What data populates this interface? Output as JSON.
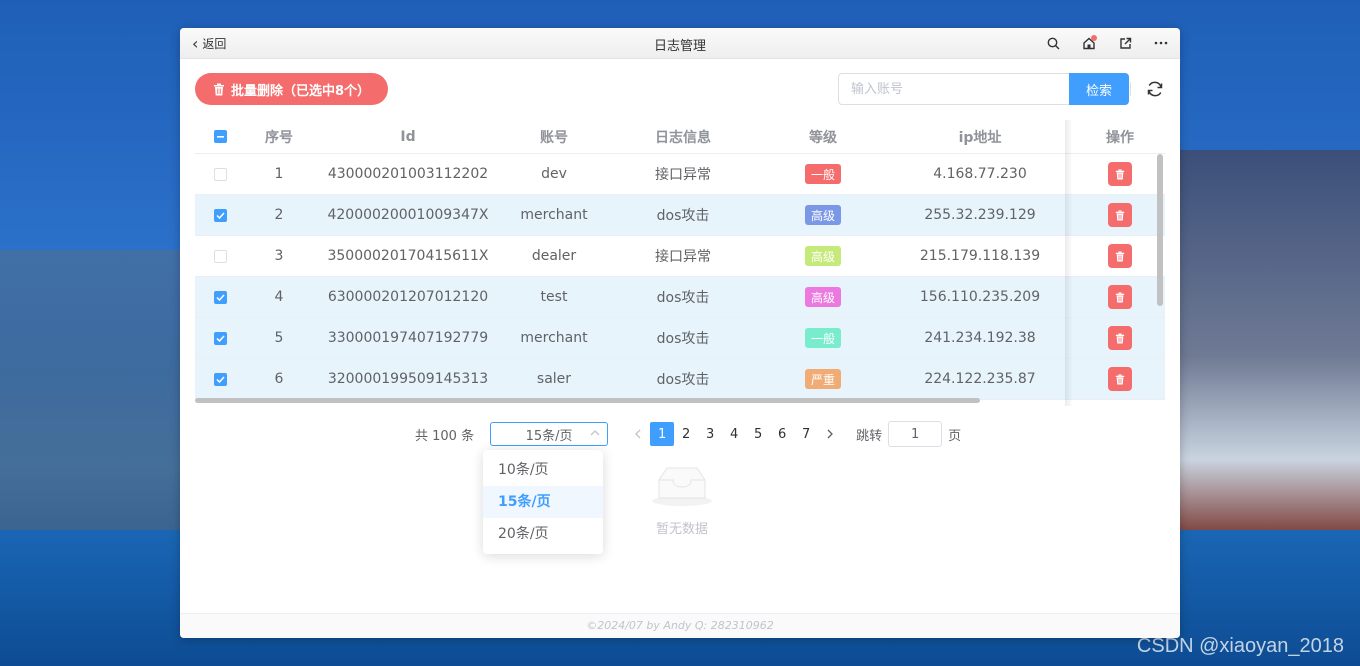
{
  "window": {
    "title": "日志管理",
    "back_label": "返回"
  },
  "toolbar": {
    "batch_delete_label": "批量删除（已选中8个）",
    "search_placeholder": "输入账号",
    "search_value": "",
    "search_button": "检索"
  },
  "table": {
    "columns": [
      "序号",
      "Id",
      "账号",
      "日志信息",
      "等级",
      "ip地址",
      "操作"
    ],
    "rows": [
      {
        "no": "1",
        "id": "430000201003112202",
        "account": "dev",
        "info": "接口异常",
        "level": "一般",
        "level_color": "#f56c6c",
        "ip": "4.168.77.230",
        "selected": false
      },
      {
        "no": "2",
        "id": "42000020001009347X",
        "account": "merchant",
        "info": "dos攻击",
        "level": "高级",
        "level_color": "#7b98e6",
        "ip": "255.32.239.129",
        "selected": true
      },
      {
        "no": "3",
        "id": "35000020170415611X",
        "account": "dealer",
        "info": "接口异常",
        "level": "高级",
        "level_color": "#c6ea7a",
        "ip": "215.179.118.139",
        "selected": false
      },
      {
        "no": "4",
        "id": "630000201207012120",
        "account": "test",
        "info": "dos攻击",
        "level": "高级",
        "level_color": "#ec79e0",
        "ip": "156.110.235.209",
        "selected": true
      },
      {
        "no": "5",
        "id": "330000197407192779",
        "account": "merchant",
        "info": "dos攻击",
        "level": "一般",
        "level_color": "#79eccd",
        "ip": "241.234.192.38",
        "selected": true
      },
      {
        "no": "6",
        "id": "320000199509145313",
        "account": "saler",
        "info": "dos攻击",
        "level": "严重",
        "level_color": "#f0ac74",
        "ip": "224.122.235.87",
        "selected": true
      }
    ]
  },
  "pagination": {
    "total_label": "共 100 条",
    "page_size_value": "15条/页",
    "page_size_options": [
      "10条/页",
      "15条/页",
      "20条/页"
    ],
    "pages": [
      "1",
      "2",
      "3",
      "4",
      "5",
      "6",
      "7"
    ],
    "current_page": "1",
    "jump_label": "跳转",
    "jump_value": "1",
    "page_suffix": "页"
  },
  "empty": {
    "text": "暂无数据"
  },
  "footer": {
    "text": "©2024/07 by Andy Q: 282310962"
  },
  "watermark": "CSDN @xiaoyan_2018",
  "colors": {
    "primary": "#409eff",
    "danger": "#f56c6c",
    "selected_row": "#e8f4fc"
  }
}
